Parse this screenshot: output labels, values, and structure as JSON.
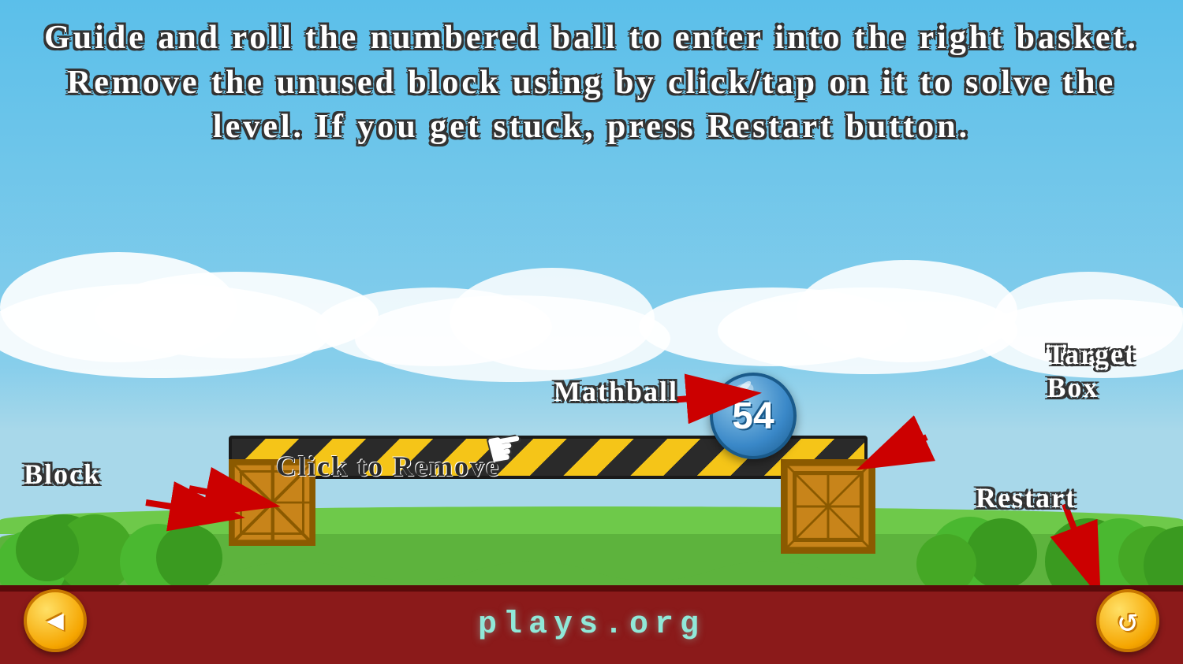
{
  "game": {
    "title": "Mathball",
    "instruction": "Guide and roll the numbered ball to enter into the right basket. Remove the unused block using by click/tap on it to solve the level. If you get stuck, press Restart button.",
    "mathball_number": "54",
    "labels": {
      "mathball": "Mathball",
      "target_box": "Target\nBox",
      "block": "Block",
      "restart": "Restart",
      "click_to_remove": "Click to Remove"
    },
    "footer": {
      "site": "plays.org"
    },
    "buttons": {
      "back": "◀",
      "restart": "↺"
    }
  }
}
